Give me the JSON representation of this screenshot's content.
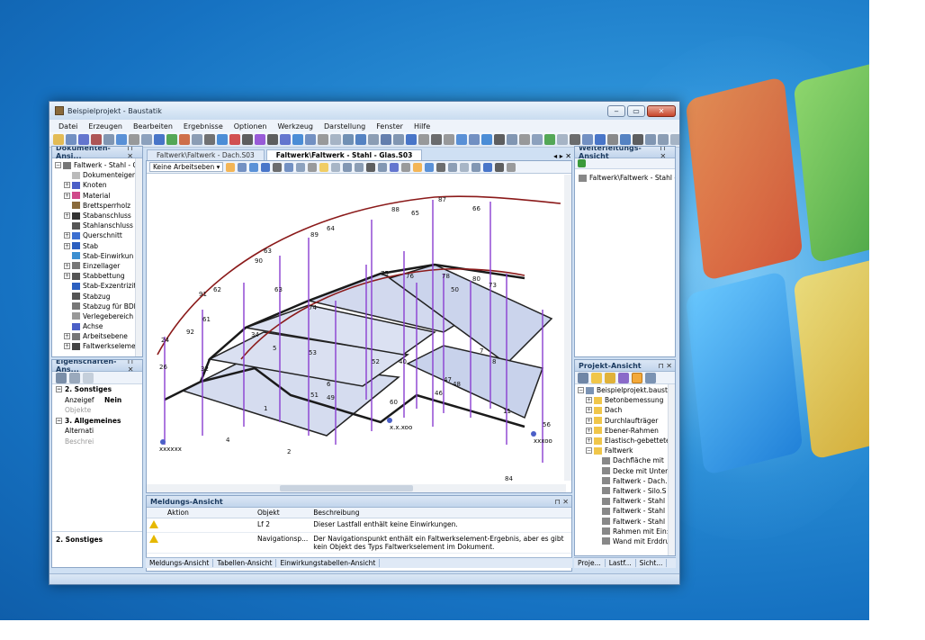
{
  "window": {
    "title": "Beispielprojekt - Baustatik",
    "min": "‒",
    "max": "▭",
    "close": "✕"
  },
  "menu": [
    "Datei",
    "Erzeugen",
    "Bearbeiten",
    "Ergebnisse",
    "Optionen",
    "Werkzeug",
    "Darstellung",
    "Fenster",
    "Hilfe"
  ],
  "doc_panel": {
    "title": "Dokumenten-Ansi...",
    "items": [
      {
        "label": "Faltwerk - Stahl - G",
        "level": 0,
        "exp": "−",
        "color": "#777"
      },
      {
        "label": "Dokumenteigen",
        "level": 1,
        "exp": "",
        "color": "#bbb"
      },
      {
        "label": "Knoten",
        "level": 1,
        "exp": "+",
        "color": "#4b5fc7"
      },
      {
        "label": "Material",
        "level": 1,
        "exp": "+",
        "color": "#d04a8a"
      },
      {
        "label": "Brettsperrholz",
        "level": 1,
        "exp": "",
        "color": "#8a6a3a"
      },
      {
        "label": "Stabanschluss",
        "level": 1,
        "exp": "+",
        "color": "#333"
      },
      {
        "label": "Stahlanschluss",
        "level": 1,
        "exp": "",
        "color": "#555"
      },
      {
        "label": "Querschnitt",
        "level": 1,
        "exp": "+",
        "color": "#3c6fd1"
      },
      {
        "label": "Stab",
        "level": 1,
        "exp": "+",
        "color": "#2b5fc0"
      },
      {
        "label": "Stab-Einwirkun",
        "level": 1,
        "exp": "",
        "color": "#3c8fd1"
      },
      {
        "label": "Einzellager",
        "level": 1,
        "exp": "+",
        "color": "#777"
      },
      {
        "label": "Stabbettung",
        "level": 1,
        "exp": "+",
        "color": "#555"
      },
      {
        "label": "Stab-Exzentrizit",
        "level": 1,
        "exp": "",
        "color": "#2b5fc0"
      },
      {
        "label": "Stabzug",
        "level": 1,
        "exp": "",
        "color": "#555"
      },
      {
        "label": "Stabzug für BDI",
        "level": 1,
        "exp": "",
        "color": "#777"
      },
      {
        "label": "Verlegebereich",
        "level": 1,
        "exp": "",
        "color": "#999"
      },
      {
        "label": "Achse",
        "level": 1,
        "exp": "",
        "color": "#4b5fc7"
      },
      {
        "label": "Arbeitsebene",
        "level": 1,
        "exp": "+",
        "color": "#777"
      },
      {
        "label": "Faltwerkselement",
        "level": 1,
        "exp": "+",
        "color": "#444"
      }
    ]
  },
  "prop_panel": {
    "title": "Eigenschaften-Ans...",
    "rows": [
      {
        "label": "2. Sonstiges",
        "bold": true,
        "exp": "−"
      },
      {
        "label": "Anzeigef",
        "value": "Nein"
      },
      {
        "label": "Objekte",
        "grey": true
      },
      {
        "label": "3. Allgemeines",
        "bold": true,
        "exp": "−"
      },
      {
        "label": "Alternati"
      },
      {
        "label": "Beschrei",
        "grey": true
      }
    ],
    "footer": "2. Sonstiges"
  },
  "doc_tabs": [
    {
      "label": "Faltwerk\\Faltwerk - Dach.S03",
      "active": false
    },
    {
      "label": "Faltwerk\\Faltwerk - Stahl - Glas.S03",
      "active": true
    }
  ],
  "viewport": {
    "workplane_combo": "Keine Arbeitseben ▾",
    "bottom_labels": [
      "xxxxxx",
      "x.x.xoo",
      "xxxoo"
    ],
    "node_labels": [
      "87",
      "66",
      "88",
      "65",
      "89",
      "64",
      "63",
      "90",
      "62",
      "91",
      "61",
      "92",
      "24",
      "26",
      "32",
      "34",
      "74",
      "76",
      "78",
      "80",
      "73",
      "75",
      "50",
      "53",
      "52",
      "49",
      "2",
      "1",
      "4",
      "5",
      "6",
      "7",
      "8",
      "11",
      "40",
      "46",
      "47",
      "48",
      "56",
      "60",
      "84",
      "51",
      "63"
    ]
  },
  "message_panel": {
    "title": "Meldungs-Ansicht",
    "columns": [
      "Aktion",
      "Objekt",
      "Beschreibung"
    ],
    "rows": [
      {
        "objekt": "Lf 2",
        "text": "Dieser Lastfall enthält keine Einwirkungen."
      },
      {
        "objekt": "Navigationsp...",
        "text": "Der Navigationspunkt enthält ein Faltwerkselement-Ergebnis, aber es gibt kein Objekt des Typs Faltwerkselement im Dokument."
      }
    ],
    "tabs": [
      "Meldungs-Ansicht",
      "Tabellen-Ansicht",
      "Einwirkungstabellen-Ansicht"
    ]
  },
  "weiter_panel": {
    "title": "Weiterleitungs-Ansicht",
    "item": "Faltwerk\\Faltwerk - Stahl - Glas"
  },
  "projekt_panel": {
    "title": "Projekt-Ansicht",
    "items": [
      {
        "label": "Beispielprojekt.baustati",
        "level": 0,
        "exp": "−",
        "kind": "proj"
      },
      {
        "label": "Betonbemessung",
        "level": 1,
        "exp": "+",
        "kind": "folder"
      },
      {
        "label": "Dach",
        "level": 1,
        "exp": "+",
        "kind": "folder"
      },
      {
        "label": "Durchlaufträger",
        "level": 1,
        "exp": "+",
        "kind": "folder"
      },
      {
        "label": "Ebener-Rahmen",
        "level": 1,
        "exp": "+",
        "kind": "folder"
      },
      {
        "label": "Elastisch-gebetteter",
        "level": 1,
        "exp": "+",
        "kind": "folder"
      },
      {
        "label": "Faltwerk",
        "level": 1,
        "exp": "−",
        "kind": "folder"
      },
      {
        "label": "Dachfläche mit",
        "level": 2,
        "exp": "",
        "kind": "doc"
      },
      {
        "label": "Decke mit Unter",
        "level": 2,
        "exp": "",
        "kind": "doc"
      },
      {
        "label": "Faltwerk - Dach.",
        "level": 2,
        "exp": "",
        "kind": "doc"
      },
      {
        "label": "Faltwerk - Silo.S",
        "level": 2,
        "exp": "",
        "kind": "doc"
      },
      {
        "label": "Faltwerk - Stahl",
        "level": 2,
        "exp": "",
        "kind": "doc"
      },
      {
        "label": "Faltwerk - Stahl",
        "level": 2,
        "exp": "",
        "kind": "doc"
      },
      {
        "label": "Faltwerk - Stahl",
        "level": 2,
        "exp": "",
        "kind": "doc"
      },
      {
        "label": "Rahmen mit Ein:",
        "level": 2,
        "exp": "",
        "kind": "doc"
      },
      {
        "label": "Wand mit Erddru",
        "level": 2,
        "exp": "",
        "kind": "doc"
      }
    ],
    "tabs": [
      "Proje...",
      "Lastf...",
      "Sicht..."
    ]
  },
  "colors": {
    "panel_head": "#c2d5ec",
    "structure_line": "#8b1a1a",
    "column_line": "#8a3fd1",
    "glass": "#c9d3ec"
  }
}
